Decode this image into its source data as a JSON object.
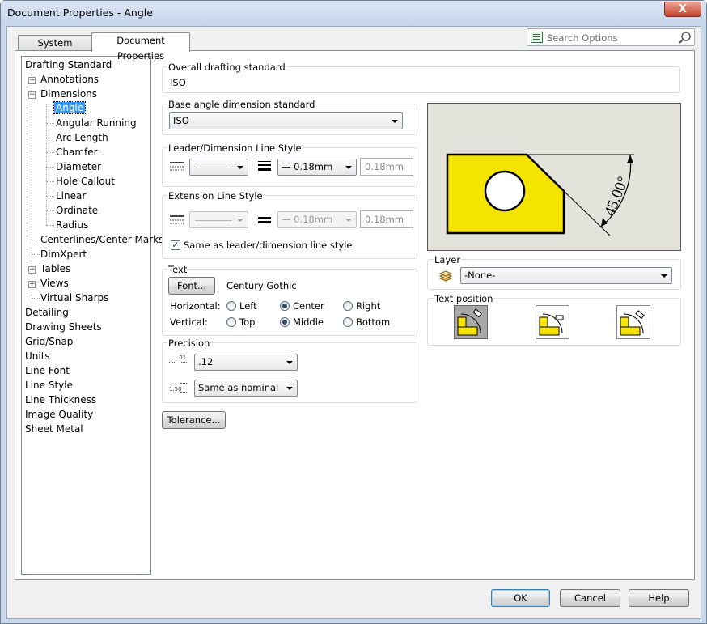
{
  "window": {
    "title": "Document Properties - Angle",
    "close_glyph": "X"
  },
  "tabs": [
    {
      "label": "System Options"
    },
    {
      "label": "Document Properties"
    }
  ],
  "search": {
    "placeholder": "Search Options"
  },
  "tree": {
    "items": [
      {
        "label": "Drafting Standard"
      },
      {
        "label": "Annotations"
      },
      {
        "label": "Dimensions"
      },
      {
        "label": "Angle"
      },
      {
        "label": "Angular Running"
      },
      {
        "label": "Arc Length"
      },
      {
        "label": "Chamfer"
      },
      {
        "label": "Diameter"
      },
      {
        "label": "Hole Callout"
      },
      {
        "label": "Linear"
      },
      {
        "label": "Ordinate"
      },
      {
        "label": "Radius"
      },
      {
        "label": "Centerlines/Center Marks"
      },
      {
        "label": "DimXpert"
      },
      {
        "label": "Tables"
      },
      {
        "label": "Views"
      },
      {
        "label": "Virtual Sharps"
      },
      {
        "label": "Detailing"
      },
      {
        "label": "Drawing Sheets"
      },
      {
        "label": "Grid/Snap"
      },
      {
        "label": "Units"
      },
      {
        "label": "Line Font"
      },
      {
        "label": "Line Style"
      },
      {
        "label": "Line Thickness"
      },
      {
        "label": "Image Quality"
      },
      {
        "label": "Sheet Metal"
      }
    ],
    "expander_plus": "+",
    "expander_minus": "−"
  },
  "overall": {
    "label": "Overall drafting standard",
    "value": "ISO"
  },
  "base_angle": {
    "label": "Base angle dimension standard",
    "value": "ISO"
  },
  "leader_style": {
    "label": "Leader/Dimension Line Style",
    "thickness": "— 0.18mm",
    "custom": "0.18mm"
  },
  "extension_style": {
    "label": "Extension Line Style",
    "thickness": "— 0.18mm",
    "custom": "0.18mm",
    "same_as_label": "Same as leader/dimension line style",
    "same_as_checked": true,
    "check_glyph": "✓"
  },
  "text": {
    "label": "Text",
    "font_button": "Font...",
    "font_name": "Century Gothic",
    "horizontal_label": "Horizontal:",
    "h_left": "Left",
    "h_center": "Center",
    "h_right": "Right",
    "h_selected": "Center",
    "vertical_label": "Vertical:",
    "v_top": "Top",
    "v_middle": "Middle",
    "v_bottom": "Bottom",
    "v_selected": "Middle"
  },
  "precision": {
    "label": "Precision",
    "primary": ".12",
    "tolerance": "Same as nominal",
    "icon1_text": ".01",
    "icon2_text": "1.50"
  },
  "tolerance_button": "Tolerance...",
  "preview": {
    "dimension_text": "45.00°",
    "part_color": "#f5e400",
    "background": "#e3e2db"
  },
  "layer": {
    "label": "Layer",
    "value": "-None-"
  },
  "text_position": {
    "label": "Text position"
  },
  "footer": {
    "ok": "OK",
    "cancel": "Cancel",
    "help": "Help"
  }
}
